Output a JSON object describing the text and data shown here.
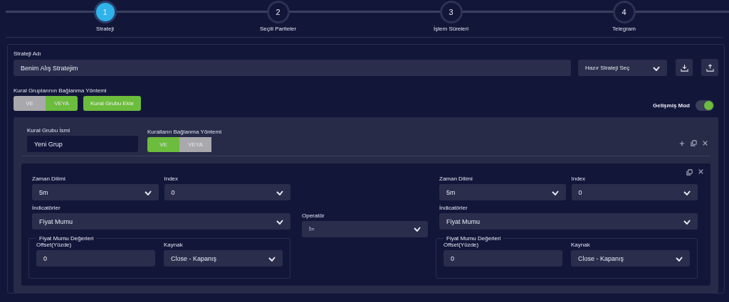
{
  "steps": [
    {
      "number": "1",
      "label": "Strateji",
      "selected": true
    },
    {
      "number": "2",
      "label": "Seçili Pariteler",
      "selected": false
    },
    {
      "number": "3",
      "label": "İşlem Süreleri",
      "selected": false
    },
    {
      "number": "4",
      "label": "Telegram",
      "selected": false
    }
  ],
  "strategy": {
    "name_label": "Strateji Adı",
    "name_value": "Benim Alış Stratejim",
    "preset_select": "Hazır Strateji Seç",
    "connection_label": "Kural Gruplarının Bağlanma Yöntemi",
    "connection_options": [
      {
        "label": "VE",
        "selected": false
      },
      {
        "label": "VEYA",
        "selected": true
      }
    ],
    "add_group_button": "Kural Grubu Ekle",
    "advanced_mode": {
      "label": "Gelişmiş Mod",
      "on": true
    }
  },
  "group": {
    "name_label": "Kural Grubu İsmi",
    "name_value": "Yeni Grup",
    "connection_label": "Kuralların Bağlanma Yöntemi",
    "connection_options": [
      {
        "label": "VE",
        "selected": true
      },
      {
        "label": "VEYA",
        "selected": false
      }
    ]
  },
  "rule": {
    "left": {
      "timeframe": {
        "label": "Zaman Dilimi",
        "value": "5m"
      },
      "index": {
        "label": "Index",
        "value": "0"
      },
      "indicator": {
        "label": "İndicatörler",
        "value": "Fiyat Mumu"
      },
      "values_title": "Fiyat Mumu Değerleri",
      "offset": {
        "label": "Offset(Yüzde)",
        "value": "0"
      },
      "source": {
        "label": "Kaynak",
        "value": "Close - Kapanış"
      }
    },
    "operator": {
      "label": "Operatör",
      "value": "!="
    },
    "right": {
      "timeframe": {
        "label": "Zaman Dilimi",
        "value": "5m"
      },
      "index": {
        "label": "Index",
        "value": "0"
      },
      "indicator": {
        "label": "İndicatörler",
        "value": "Fiyat Mumu"
      },
      "values_title": "Fiyat Mumu Değerleri",
      "offset": {
        "label": "Offset(Yüzde)",
        "value": "0"
      },
      "source": {
        "label": "Kaynak",
        "value": "Close - Kapanış"
      }
    }
  }
}
